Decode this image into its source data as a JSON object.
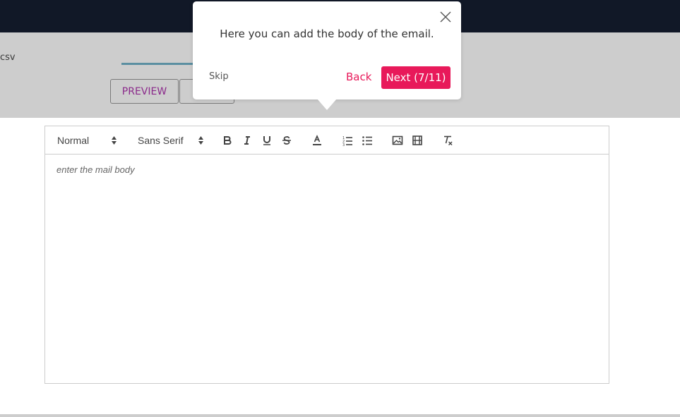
{
  "header": {
    "csv_text": "csv"
  },
  "tabs": {
    "preview_label": "PREVIEW"
  },
  "editor": {
    "header_picker": "Normal",
    "font_picker": "Sans Serif",
    "placeholder": "enter the mail body",
    "tools": [
      "bold-icon",
      "italic-icon",
      "underline-icon",
      "strike-icon",
      "color-icon",
      "ordered-list-icon",
      "bullet-list-icon",
      "image-icon",
      "video-icon",
      "clean-format-icon"
    ]
  },
  "tour": {
    "message": "Here you can add the body of the email.",
    "skip_label": "Skip",
    "back_label": "Back",
    "next_label": "Next (7/11)"
  },
  "colors": {
    "accent": "#e8195a",
    "topbar": "#111827",
    "overlay": "#cdcdcd",
    "tab_underline": "#5b8fa1",
    "preview_text": "#8b2a8b"
  }
}
